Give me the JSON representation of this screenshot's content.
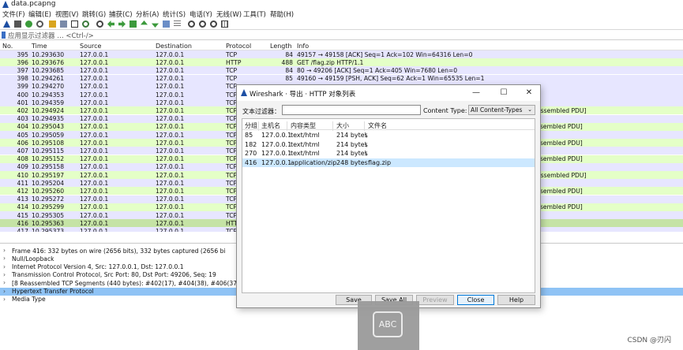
{
  "window": {
    "title": "data.pcapng"
  },
  "menu": [
    "文件(F)",
    "编辑(E)",
    "视图(V)",
    "跳转(G)",
    "捕获(C)",
    "分析(A)",
    "统计(S)",
    "电话(Y)",
    "无线(W)",
    "工具(T)",
    "帮助(H)"
  ],
  "filter": {
    "placeholder": "应用显示过滤器 … <Ctrl-/>"
  },
  "packet_list": {
    "columns": {
      "no": "No.",
      "time": "Time",
      "source": "Source",
      "destination": "Destination",
      "protocol": "Protocol",
      "length": "Length",
      "info": "Info"
    },
    "rows": [
      {
        "no": "395",
        "time": "10.293630",
        "src": "127.0.0.1",
        "dst": "127.0.0.1",
        "proto": "TCP",
        "len": "84",
        "info": "49157 → 49158 [ACK] Seq=1 Ack=102 Win=64316 Len=0",
        "type": "tcp"
      },
      {
        "no": "396",
        "time": "10.293676",
        "src": "127.0.0.1",
        "dst": "127.0.0.1",
        "proto": "HTTP",
        "len": "488",
        "info": "GET /flag.zip HTTP/1.1",
        "type": "http"
      },
      {
        "no": "397",
        "time": "10.293685",
        "src": "127.0.0.1",
        "dst": "127.0.0.1",
        "proto": "TCP",
        "len": "84",
        "info": "80 → 49206 [ACK] Seq=1 Ack=405 Win=7680 Len=0",
        "type": "tcp"
      },
      {
        "no": "398",
        "time": "10.294261",
        "src": "127.0.0.1",
        "dst": "127.0.0.1",
        "proto": "TCP",
        "len": "85",
        "info": "49160 → 49159 [PSH, ACK] Seq=62 Ack=1 Win=65535 Len=1",
        "type": "tcp"
      },
      {
        "no": "399",
        "time": "10.294270",
        "src": "127.0.0.1",
        "dst": "127.0.0.1",
        "proto": "TCP",
        "len": "",
        "info": "",
        "type": "tcp"
      },
      {
        "no": "400",
        "time": "10.294353",
        "src": "127.0.0.1",
        "dst": "127.0.0.1",
        "proto": "TCP",
        "len": "",
        "info": "",
        "type": "tcp"
      },
      {
        "no": "401",
        "time": "10.294359",
        "src": "127.0.0.1",
        "dst": "127.0.0.1",
        "proto": "TCP",
        "len": "",
        "info": "",
        "type": "tcp"
      },
      {
        "no": "402",
        "time": "10.294924",
        "src": "127.0.0.1",
        "dst": "127.0.0.1",
        "proto": "TCP",
        "len": "",
        "info": "assembled PDU]",
        "type": "http"
      },
      {
        "no": "403",
        "time": "10.294935",
        "src": "127.0.0.1",
        "dst": "127.0.0.1",
        "proto": "TCP",
        "len": "",
        "info": "",
        "type": "tcp"
      },
      {
        "no": "404",
        "time": "10.295043",
        "src": "127.0.0.1",
        "dst": "127.0.0.1",
        "proto": "TCP",
        "len": "",
        "info": "ssembled PDU]",
        "type": "http"
      },
      {
        "no": "405",
        "time": "10.295059",
        "src": "127.0.0.1",
        "dst": "127.0.0.1",
        "proto": "TCP",
        "len": "",
        "info": "",
        "type": "tcp"
      },
      {
        "no": "406",
        "time": "10.295108",
        "src": "127.0.0.1",
        "dst": "127.0.0.1",
        "proto": "TCP",
        "len": "",
        "info": "ssembled PDU]",
        "type": "http"
      },
      {
        "no": "407",
        "time": "10.295115",
        "src": "127.0.0.1",
        "dst": "127.0.0.1",
        "proto": "TCP",
        "len": "",
        "info": "",
        "type": "tcp"
      },
      {
        "no": "408",
        "time": "10.295152",
        "src": "127.0.0.1",
        "dst": "127.0.0.1",
        "proto": "TCP",
        "len": "",
        "info": "ssembled PDU]",
        "type": "http"
      },
      {
        "no": "409",
        "time": "10.295158",
        "src": "127.0.0.1",
        "dst": "127.0.0.1",
        "proto": "TCP",
        "len": "",
        "info": "",
        "type": "tcp"
      },
      {
        "no": "410",
        "time": "10.295197",
        "src": "127.0.0.1",
        "dst": "127.0.0.1",
        "proto": "TCP",
        "len": "",
        "info": "assembled PDU]",
        "type": "http"
      },
      {
        "no": "411",
        "time": "10.295204",
        "src": "127.0.0.1",
        "dst": "127.0.0.1",
        "proto": "TCP",
        "len": "",
        "info": "",
        "type": "tcp"
      },
      {
        "no": "412",
        "time": "10.295260",
        "src": "127.0.0.1",
        "dst": "127.0.0.1",
        "proto": "TCP",
        "len": "",
        "info": "ssembled PDU]",
        "type": "http"
      },
      {
        "no": "413",
        "time": "10.295272",
        "src": "127.0.0.1",
        "dst": "127.0.0.1",
        "proto": "TCP",
        "len": "",
        "info": "",
        "type": "tcp"
      },
      {
        "no": "414",
        "time": "10.295299",
        "src": "127.0.0.1",
        "dst": "127.0.0.1",
        "proto": "TCP",
        "len": "",
        "info": "ssembled PDU]",
        "type": "http"
      },
      {
        "no": "415",
        "time": "10.295305",
        "src": "127.0.0.1",
        "dst": "127.0.0.1",
        "proto": "TCP",
        "len": "",
        "info": "",
        "type": "tcp"
      },
      {
        "no": "416",
        "time": "10.295363",
        "src": "127.0.0.1",
        "dst": "127.0.0.1",
        "proto": "HTTI",
        "len": "",
        "info": "",
        "type": "sel"
      },
      {
        "no": "417",
        "time": "10.295373",
        "src": "127.0.0.1",
        "dst": "127.0.0.1",
        "proto": "TCP",
        "len": "",
        "info": "",
        "type": "tcp cut"
      }
    ]
  },
  "details": [
    {
      "arrow": "›",
      "text": "Frame 416: 332 bytes on wire (2656 bits), 332 bytes captured (2656 bi",
      "selected": false
    },
    {
      "arrow": "›",
      "text": "Null/Loopback",
      "selected": false
    },
    {
      "arrow": "›",
      "text": "Internet Protocol Version 4, Src: 127.0.0.1, Dst: 127.0.0.1",
      "selected": false
    },
    {
      "arrow": "›",
      "text": "Transmission Control Protocol, Src Port: 80, Dst Port: 49206, Seq: 19",
      "selected": false
    },
    {
      "arrow": "›",
      "text": "[8 Reassembled TCP Segments (440 bytes): #402(17), #404(38), #406(37)",
      "selected": false
    },
    {
      "arrow": "›",
      "text": "Hypertext Transfer Protocol",
      "selected": true
    },
    {
      "arrow": "›",
      "text": "Media Type",
      "selected": false
    }
  ],
  "dialog": {
    "title": "Wireshark · 导出 · HTTP 对象列表",
    "filter_label": "文本过滤器：",
    "content_type_label": "Content Type:",
    "content_type_value": "All Content-Types",
    "columns": {
      "group": "分组",
      "host": "主机名",
      "ctype": "内容类型",
      "size": "大小",
      "filename": "文件名"
    },
    "rows": [
      {
        "group": "85",
        "host": "127.0.0.1",
        "ctype": "text/html",
        "size": "214 bytes",
        "filename": "\\",
        "selected": false
      },
      {
        "group": "182",
        "host": "127.0.0.1",
        "ctype": "text/html",
        "size": "214 bytes",
        "filename": "\\",
        "selected": false
      },
      {
        "group": "270",
        "host": "127.0.0.1",
        "ctype": "text/html",
        "size": "214 bytes",
        "filename": "\\",
        "selected": false
      },
      {
        "group": "416",
        "host": "127.0.0.1",
        "ctype": "application/zip",
        "size": "248 bytes",
        "filename": "flag.zip",
        "selected": true
      }
    ],
    "buttons": {
      "save": "Save",
      "save_all": "Save All",
      "preview": "Preview",
      "close": "Close",
      "help": "Help"
    }
  },
  "overlay": {
    "label": "ABC"
  },
  "watermark": "CSDN @刃闪",
  "colors": {
    "tcp_row": "#e7e6ff",
    "http_row": "#e4ffc7",
    "selected_packet": "#c5e3a5",
    "selected_detail": "#8fc3f5",
    "dialog_selected_row": "#cce8ff"
  }
}
